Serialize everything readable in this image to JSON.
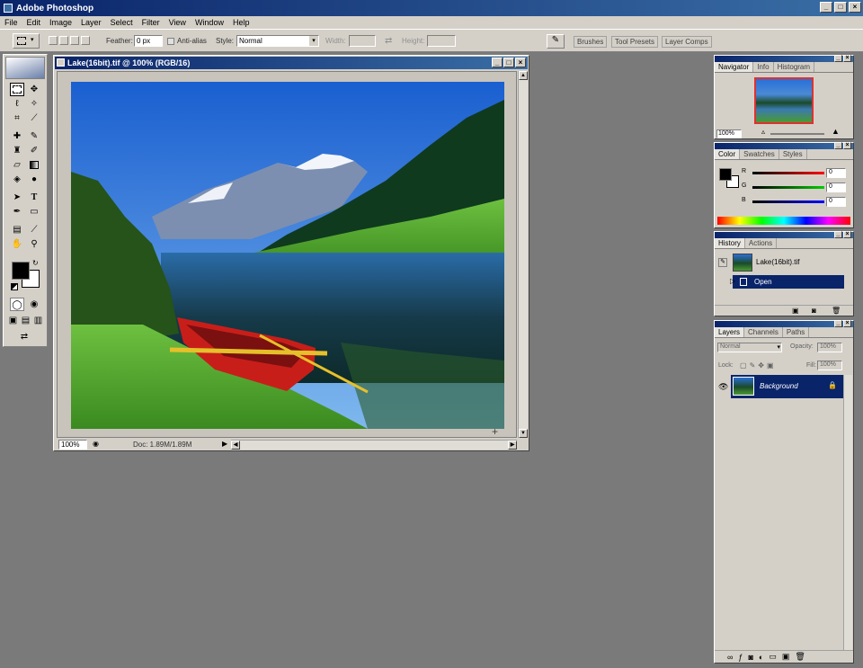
{
  "app": {
    "title": "Adobe Photoshop",
    "window_controls": [
      "_",
      "□",
      "×"
    ]
  },
  "menu": [
    "File",
    "Edit",
    "Image",
    "Layer",
    "Select",
    "Filter",
    "View",
    "Window",
    "Help"
  ],
  "options_bar": {
    "feather_label": "Feather:",
    "feather_value": "0 px",
    "antialiased_label": "Anti-alias",
    "style_label": "Style:",
    "style_value": "Normal",
    "width_label": "Width:",
    "height_label": "Height:",
    "palette_well_tabs": [
      "Brushes",
      "Tool Presets",
      "Layer Comps"
    ]
  },
  "document": {
    "title": "Lake(16bit).tif @ 100% (RGB/16)",
    "zoom": "100%",
    "doc_size": "Doc: 1.89M/1.89M"
  },
  "navigator": {
    "tabs": [
      "Navigator",
      "Info",
      "Histogram"
    ],
    "zoom": "100%"
  },
  "color": {
    "tabs": [
      "Color",
      "Swatches",
      "Styles"
    ],
    "channels": [
      {
        "label": "R",
        "value": "0",
        "color": "#cc0000"
      },
      {
        "label": "G",
        "value": "0",
        "color": "#00aa00"
      },
      {
        "label": "B",
        "value": "0",
        "color": "#0000cc"
      }
    ]
  },
  "history": {
    "tabs": [
      "History",
      "Actions"
    ],
    "snapshot": "Lake(16bit).tif",
    "items": [
      "Open"
    ]
  },
  "layers": {
    "tabs": [
      "Layers",
      "Channels",
      "Paths"
    ],
    "blend_mode": "Normal",
    "opacity_label": "Opacity:",
    "opacity_value": "100%",
    "lock_label": "Lock:",
    "fill_label": "Fill:",
    "fill_value": "100%",
    "layer_items": [
      "Background"
    ]
  },
  "colors": {
    "workspace": "#7a7a7a",
    "chrome": "#d4d0c8",
    "titlebar": "#0a246a",
    "selection": "#0a246a"
  }
}
